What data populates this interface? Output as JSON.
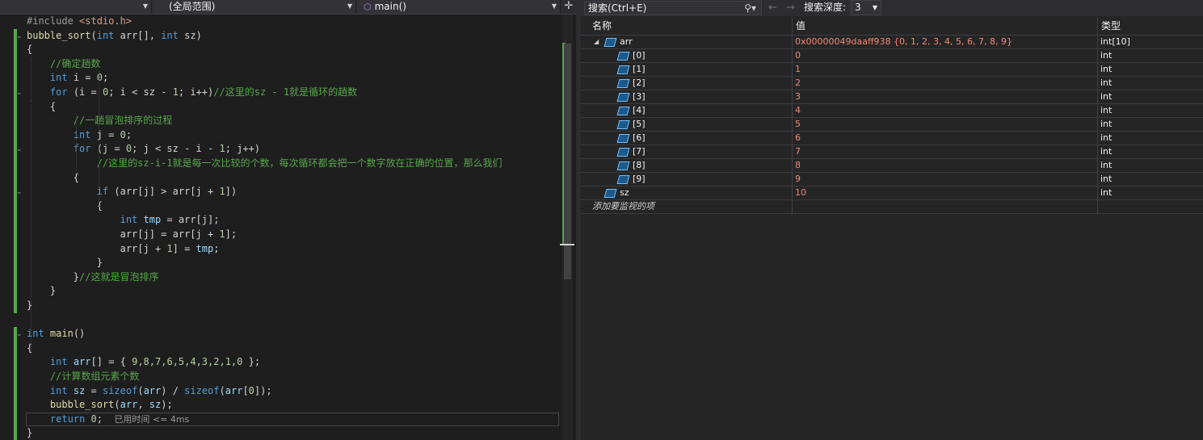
{
  "editor": {
    "scope_dropdown": "(全局范围)",
    "function_dropdown": "main()",
    "split_icon": "split-icon",
    "code_lines": [
      [
        {
          "t": "#include ",
          "c": "pp"
        },
        {
          "t": "<stdio.h>",
          "c": "s"
        }
      ],
      [
        {
          "t": "bubble_sort",
          "c": "f"
        },
        {
          "t": "(",
          "c": "t"
        },
        {
          "t": "int",
          "c": "k"
        },
        {
          "t": " arr[], ",
          "c": "t"
        },
        {
          "t": "int",
          "c": "k"
        },
        {
          "t": " sz)",
          "c": "t"
        }
      ],
      [
        {
          "t": "{",
          "c": "t"
        }
      ],
      [
        {
          "t": "    //确定趟数",
          "c": "c"
        }
      ],
      [
        {
          "t": "    ",
          "c": "t"
        },
        {
          "t": "int",
          "c": "k"
        },
        {
          "t": " i = ",
          "c": "t"
        },
        {
          "t": "0",
          "c": "n"
        },
        {
          "t": ";",
          "c": "t"
        }
      ],
      [
        {
          "t": "    ",
          "c": "t"
        },
        {
          "t": "for",
          "c": "k"
        },
        {
          "t": " (i = ",
          "c": "t"
        },
        {
          "t": "0",
          "c": "n"
        },
        {
          "t": "; i < sz - ",
          "c": "t"
        },
        {
          "t": "1",
          "c": "n"
        },
        {
          "t": "; i++)",
          "c": "t"
        },
        {
          "t": "//这里的sz - 1就是循环的趟数",
          "c": "c"
        }
      ],
      [
        {
          "t": "    {",
          "c": "t"
        }
      ],
      [
        {
          "t": "        //一趟冒泡排序的过程",
          "c": "c"
        }
      ],
      [
        {
          "t": "        ",
          "c": "t"
        },
        {
          "t": "int",
          "c": "k"
        },
        {
          "t": " j = ",
          "c": "t"
        },
        {
          "t": "0",
          "c": "n"
        },
        {
          "t": ";",
          "c": "t"
        }
      ],
      [
        {
          "t": "        ",
          "c": "t"
        },
        {
          "t": "for",
          "c": "k"
        },
        {
          "t": " (j = ",
          "c": "t"
        },
        {
          "t": "0",
          "c": "n"
        },
        {
          "t": "; j < sz - i - ",
          "c": "t"
        },
        {
          "t": "1",
          "c": "n"
        },
        {
          "t": "; j++)",
          "c": "t"
        }
      ],
      [
        {
          "t": "            //这里的sz-i-1就是每一次比较的个数，每次循环都会把一个数字放在正确的位置，那么我们",
          "c": "c"
        }
      ],
      [
        {
          "t": "        {",
          "c": "t"
        }
      ],
      [
        {
          "t": "            ",
          "c": "t"
        },
        {
          "t": "if",
          "c": "k"
        },
        {
          "t": " (arr[j] > arr[j + ",
          "c": "t"
        },
        {
          "t": "1",
          "c": "n"
        },
        {
          "t": "])",
          "c": "t"
        }
      ],
      [
        {
          "t": "            {",
          "c": "t"
        }
      ],
      [
        {
          "t": "                ",
          "c": "t"
        },
        {
          "t": "int",
          "c": "k"
        },
        {
          "t": " ",
          "c": "t"
        },
        {
          "t": "tmp",
          "c": "v"
        },
        {
          "t": " = arr[j];",
          "c": "t"
        }
      ],
      [
        {
          "t": "                arr[j] = arr[j + ",
          "c": "t"
        },
        {
          "t": "1",
          "c": "n"
        },
        {
          "t": "];",
          "c": "t"
        }
      ],
      [
        {
          "t": "                arr[j + ",
          "c": "t"
        },
        {
          "t": "1",
          "c": "n"
        },
        {
          "t": "] = ",
          "c": "t"
        },
        {
          "t": "tmp",
          "c": "v"
        },
        {
          "t": ";",
          "c": "t"
        }
      ],
      [
        {
          "t": "            }",
          "c": "t"
        }
      ],
      [
        {
          "t": "        }",
          "c": "t"
        },
        {
          "t": "//这就是冒泡排序",
          "c": "c"
        }
      ],
      [
        {
          "t": "    }",
          "c": "t"
        }
      ],
      [
        {
          "t": "}",
          "c": "t"
        }
      ],
      [
        {
          "t": "",
          "c": "t"
        }
      ],
      [
        {
          "t": "int",
          "c": "k"
        },
        {
          "t": " ",
          "c": "t"
        },
        {
          "t": "main",
          "c": "f"
        },
        {
          "t": "()",
          "c": "t"
        }
      ],
      [
        {
          "t": "{",
          "c": "t"
        }
      ],
      [
        {
          "t": "    ",
          "c": "t"
        },
        {
          "t": "int",
          "c": "k"
        },
        {
          "t": " ",
          "c": "t"
        },
        {
          "t": "arr",
          "c": "v"
        },
        {
          "t": "[] = { ",
          "c": "t"
        },
        {
          "t": "9,8,7,6,5,4,3,2,1,0",
          "c": "n"
        },
        {
          "t": " };",
          "c": "t"
        }
      ],
      [
        {
          "t": "    //计算数组元素个数",
          "c": "c"
        }
      ],
      [
        {
          "t": "    ",
          "c": "t"
        },
        {
          "t": "int",
          "c": "k"
        },
        {
          "t": " ",
          "c": "t"
        },
        {
          "t": "sz",
          "c": "v"
        },
        {
          "t": " = ",
          "c": "t"
        },
        {
          "t": "sizeof",
          "c": "k"
        },
        {
          "t": "(",
          "c": "t"
        },
        {
          "t": "arr",
          "c": "v"
        },
        {
          "t": ") / ",
          "c": "t"
        },
        {
          "t": "sizeof",
          "c": "k"
        },
        {
          "t": "(",
          "c": "t"
        },
        {
          "t": "arr",
          "c": "v"
        },
        {
          "t": "[",
          "c": "t"
        },
        {
          "t": "0",
          "c": "n"
        },
        {
          "t": "]);",
          "c": "t"
        }
      ],
      [
        {
          "t": "    ",
          "c": "t"
        },
        {
          "t": "bubble_sort",
          "c": "f"
        },
        {
          "t": "(",
          "c": "t"
        },
        {
          "t": "arr",
          "c": "v"
        },
        {
          "t": ", ",
          "c": "t"
        },
        {
          "t": "sz",
          "c": "v"
        },
        {
          "t": ");",
          "c": "t"
        }
      ],
      [
        {
          "t": "    ",
          "c": "t"
        },
        {
          "t": "return",
          "c": "k"
        },
        {
          "t": " ",
          "c": "t"
        },
        {
          "t": "0",
          "c": "n"
        },
        {
          "t": ";  ",
          "c": "t"
        },
        {
          "t": "已用时间 <= 4ms",
          "c": "hint"
        }
      ],
      [
        {
          "t": "}",
          "c": "t"
        }
      ]
    ]
  },
  "watch": {
    "search_placeholder": "搜索(Ctrl+E)",
    "search_icon": "search-icon",
    "back_icon": "arrow-left-icon",
    "forward_icon": "arrow-right-icon",
    "depth_label": "搜索深度:",
    "depth_value": "3",
    "columns": {
      "name": "名称",
      "value": "值",
      "type": "类型"
    },
    "rows": [
      {
        "name": "arr",
        "value": "0x00000049daaff938 {0, 1, 2, 3, 4, 5, 6, 7, 8, 9}",
        "type": "int[10]",
        "expanded": true,
        "level": 0
      },
      {
        "name": "[0]",
        "value": "0",
        "type": "int",
        "level": 1
      },
      {
        "name": "[1]",
        "value": "1",
        "type": "int",
        "level": 1
      },
      {
        "name": "[2]",
        "value": "2",
        "type": "int",
        "level": 1
      },
      {
        "name": "[3]",
        "value": "3",
        "type": "int",
        "level": 1
      },
      {
        "name": "[4]",
        "value": "4",
        "type": "int",
        "level": 1
      },
      {
        "name": "[5]",
        "value": "5",
        "type": "int",
        "level": 1
      },
      {
        "name": "[6]",
        "value": "6",
        "type": "int",
        "level": 1
      },
      {
        "name": "[7]",
        "value": "7",
        "type": "int",
        "level": 1
      },
      {
        "name": "[8]",
        "value": "8",
        "type": "int",
        "level": 1
      },
      {
        "name": "[9]",
        "value": "9",
        "type": "int",
        "level": 1
      },
      {
        "name": "sz",
        "value": "10",
        "type": "int",
        "level": 0
      }
    ],
    "add_item": "添加要监视的项"
  }
}
